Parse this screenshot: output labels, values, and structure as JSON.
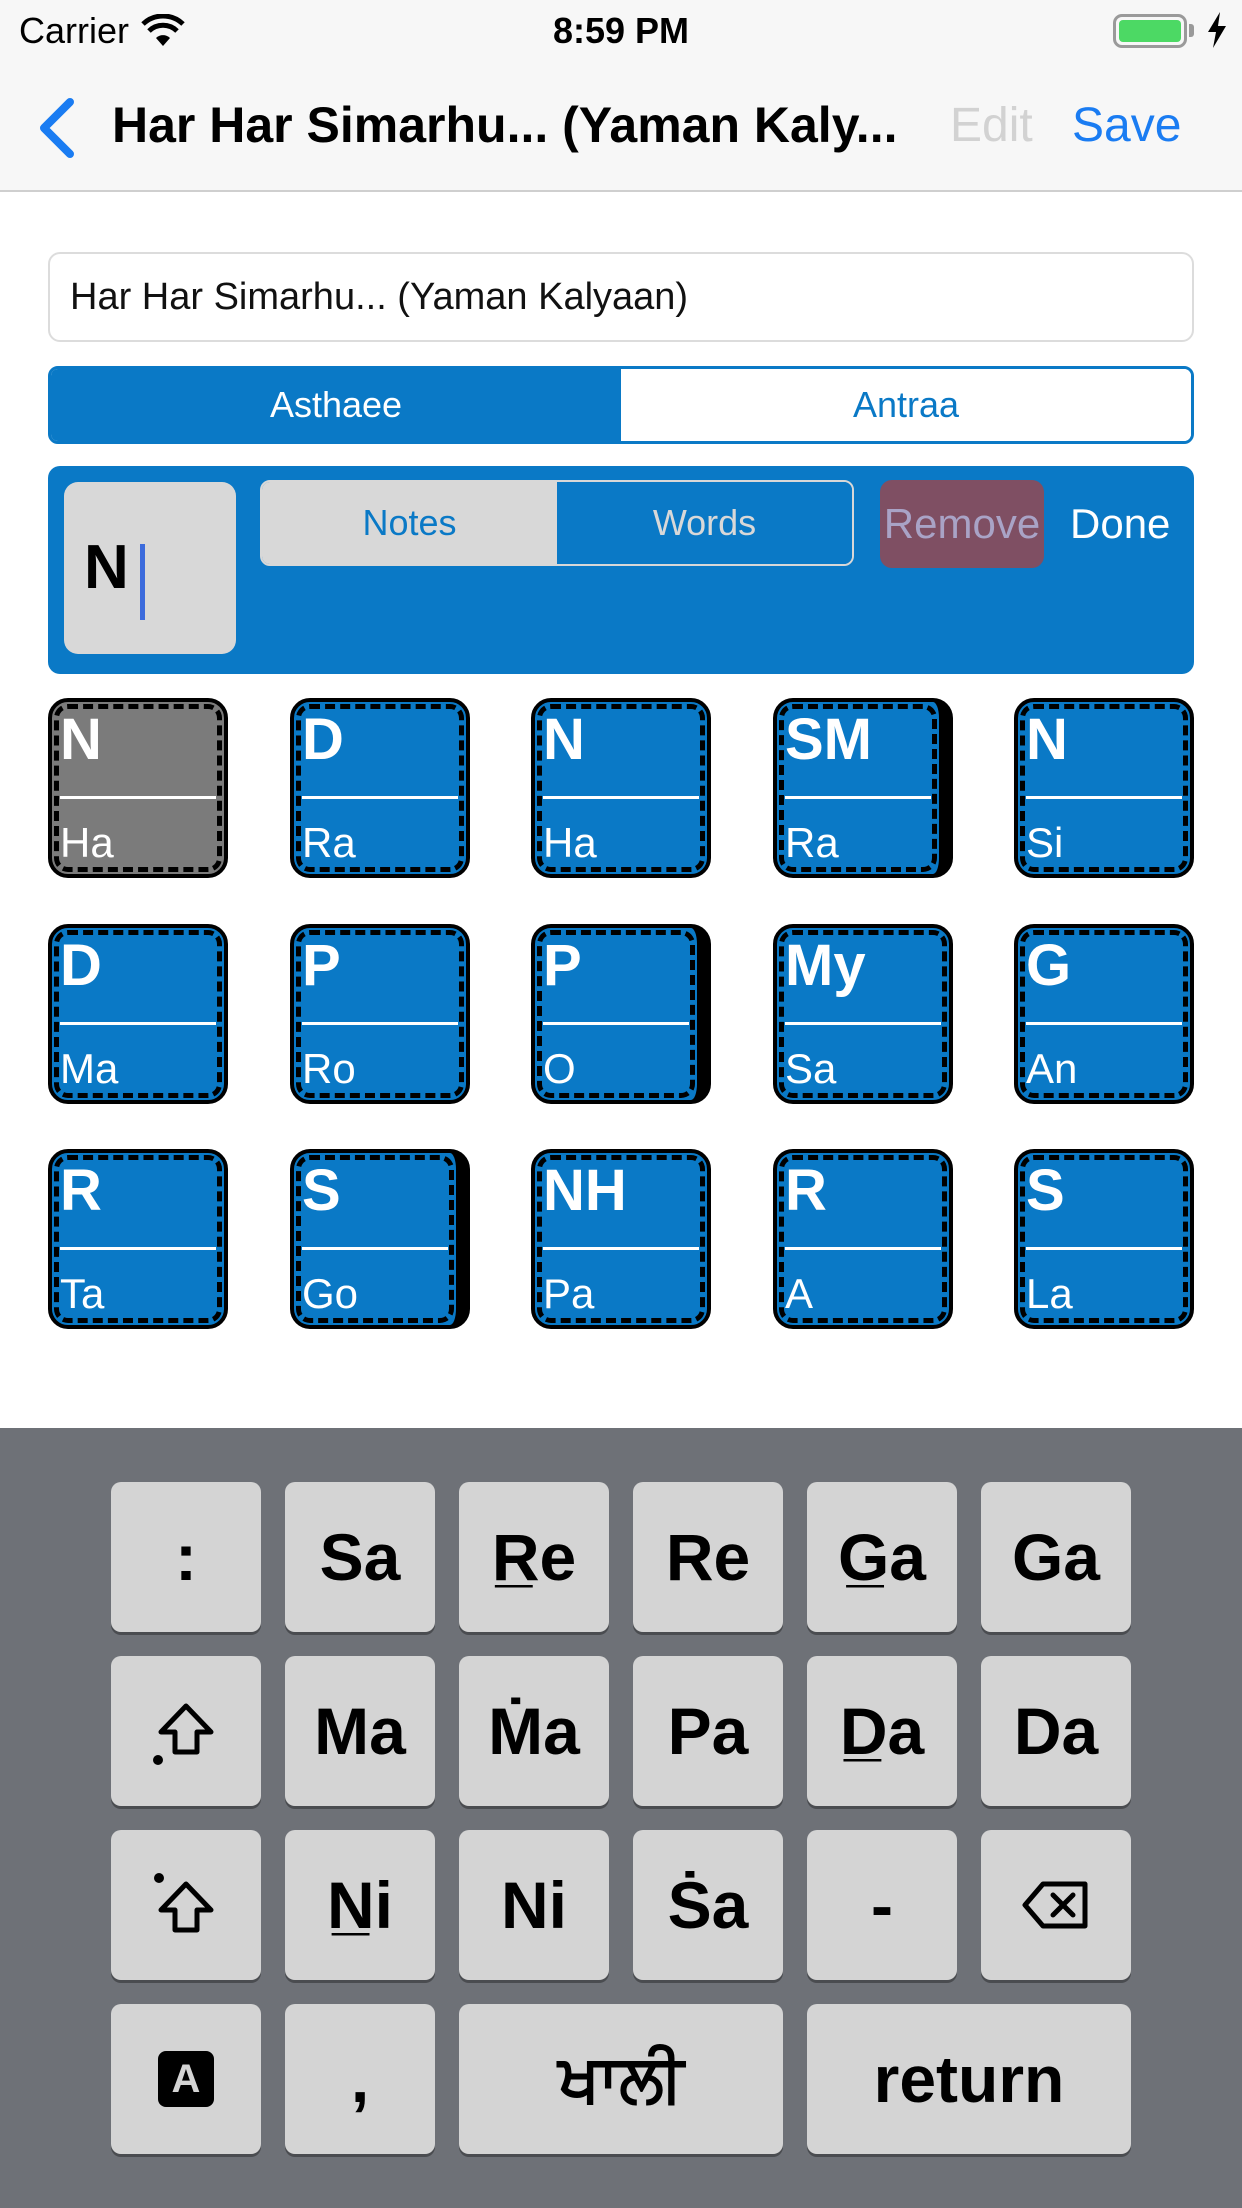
{
  "status_bar": {
    "carrier": "Carrier",
    "time": "8:59 PM"
  },
  "nav": {
    "title": "Har Har Simarhu... (Yaman Kaly...",
    "edit": "Edit",
    "save": "Save"
  },
  "title_field": {
    "value": "Har Har Simarhu... (Yaman Kalyaan)"
  },
  "sections": {
    "asthaee": "Asthaee",
    "antraa": "Antraa"
  },
  "editor": {
    "input_value": "N",
    "notes_tab": "Notes",
    "words_tab": "Words",
    "remove": "Remove",
    "done": "Done"
  },
  "cells": [
    {
      "note": "N",
      "word": "Ha"
    },
    {
      "note": "D",
      "word": "Ra"
    },
    {
      "note": "N",
      "word": "Ha"
    },
    {
      "note": "SM",
      "word": "Ra"
    },
    {
      "note": "N",
      "word": "Si"
    },
    {
      "note": "D",
      "word": "Ma"
    },
    {
      "note": "P",
      "word": "Ro"
    },
    {
      "note": "P",
      "word": "O"
    },
    {
      "note": "My",
      "word": "Sa"
    },
    {
      "note": "G",
      "word": "An"
    },
    {
      "note": "R",
      "word": "Ta"
    },
    {
      "note": "S",
      "word": "Go"
    },
    {
      "note": "NH",
      "word": "Pa"
    },
    {
      "note": "R",
      "word": "A"
    },
    {
      "note": "S",
      "word": "La"
    }
  ],
  "keyboard": {
    "row1": [
      ":",
      "Sa",
      "R̲e",
      "Re",
      "G̲a",
      "Ga"
    ],
    "row2": [
      "Ma",
      "Ṁa",
      "Pa",
      "D̲a",
      "Da"
    ],
    "row3": [
      "N̲i",
      "Ni",
      "Ṡa",
      "-"
    ],
    "row4": {
      "comma": ",",
      "space": "ਖਾਲੀ",
      "return": "return",
      "abc": "A"
    }
  },
  "colors": {
    "accent": "#0a79c6",
    "ios_blue": "#1a7cf2",
    "remove_bg": "#7f4f63",
    "selected_cell": "#7b7b7b",
    "keyboard_bg": "#6e7177"
  }
}
